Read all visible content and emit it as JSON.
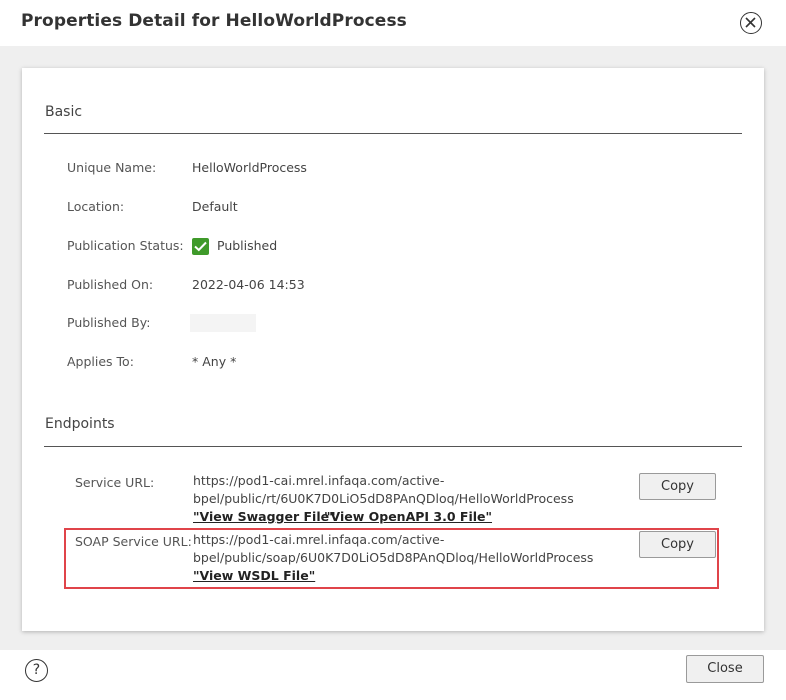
{
  "dialog": {
    "title": "Properties Detail for HelloWorldProcess",
    "close_icon": "close-circle-icon",
    "help_icon_glyph": "?",
    "close_button_label": "Close"
  },
  "basic": {
    "section_title": "Basic",
    "fields": {
      "unique_name": {
        "label": "Unique Name:",
        "value": "HelloWorldProcess"
      },
      "location": {
        "label": "Location:",
        "value": "Default"
      },
      "publication_status": {
        "label": "Publication Status:",
        "value": "Published",
        "icon": "checkmark-icon",
        "icon_color": "#3f9a2a"
      },
      "published_on": {
        "label": "Published On:",
        "value": "2022-04-06 14:53"
      },
      "published_by": {
        "label": "Published By:",
        "value": ""
      },
      "applies_to": {
        "label": "Applies To:",
        "value": "* Any *"
      }
    }
  },
  "endpoints": {
    "section_title": "Endpoints",
    "service_url": {
      "label": "Service URL:",
      "url_line1": "https://pod1-cai.mrel.infaqa.com/active-",
      "url_line2": "bpel/public/rt/6U0K7D0LiO5dD8PAnQDloq/HelloWorldProcess",
      "link_swagger": "\"View Swagger File\"",
      "link_openapi": "\"View OpenAPI 3.0 File\"",
      "copy_label": "Copy"
    },
    "soap_service_url": {
      "label": "SOAP Service URL:",
      "url_line1": "https://pod1-cai.mrel.infaqa.com/active-",
      "url_line2": "bpel/public/soap/6U0K7D0LiO5dD8PAnQDloq/HelloWorldProcess",
      "link_wsdl": "\"View WSDL File\"",
      "copy_label": "Copy",
      "highlight_color": "#e0444a"
    }
  }
}
